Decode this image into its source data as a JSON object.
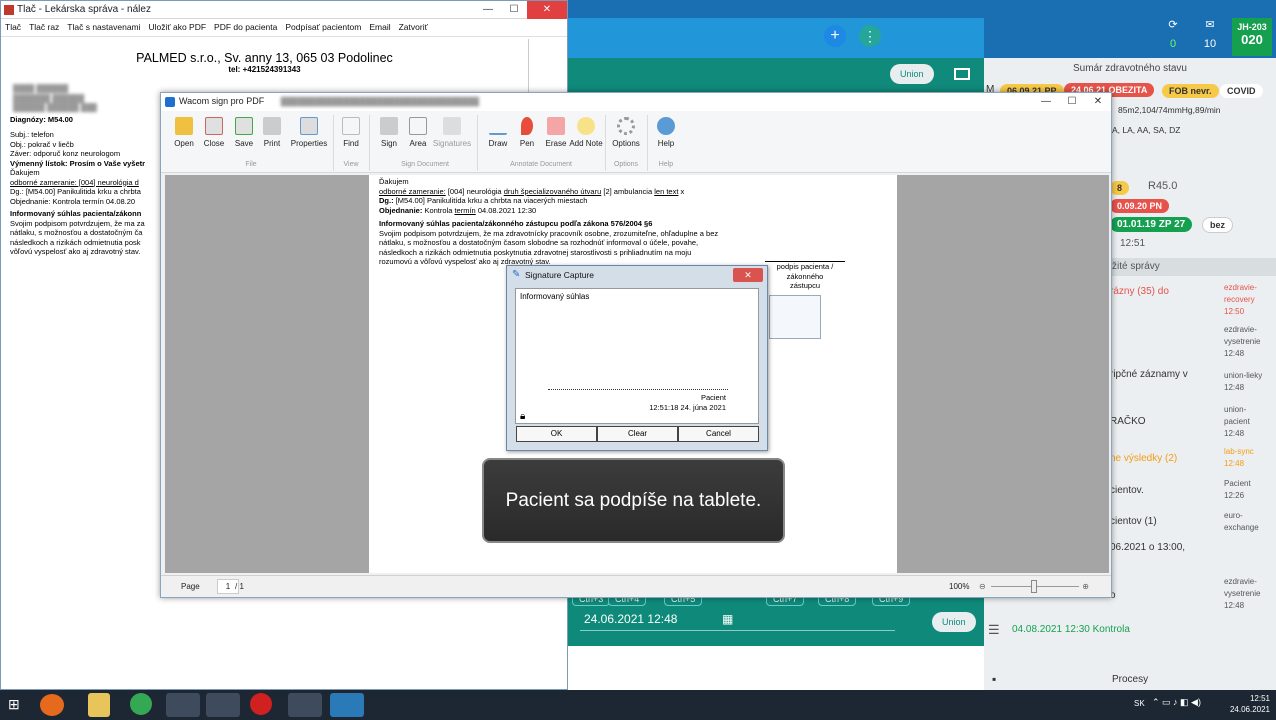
{
  "app": {
    "header_stats": {
      "sync_count": "0",
      "msg_count": "10",
      "user_code": "JH-203",
      "user_num": "020"
    },
    "union_label": "Union",
    "summary_title": "Sumár zdravotného stavu",
    "tags": {
      "m": "M",
      "pp": "06.09.21 PP",
      "obezita": "24.06.21 OBEZITA",
      "fob": "FOB nevr.",
      "covid": "COVID",
      "vitals": "85m2,104/74mmHg,89/min",
      "dx_list": "A, LA, AA, SA, DZ",
      "r45": "R45.0",
      "pn": "0.09.20 PN",
      "zp": "01.01.19 ZP 27",
      "bez": "bez",
      "time": "12:51",
      "small": "8"
    },
    "right_section_title": "žité správy",
    "right_items": [
      {
        "label": "rázny (35) do",
        "status": "ezdravie-\nrecovery\n12:50"
      },
      {
        "label": "",
        "status": "ezdravie-\nvysetrenie\n12:48"
      },
      {
        "label": "ripčné záznamy v\n",
        "status": "union-lieky\n12:48"
      },
      {
        "label": "RAČKO",
        "status": "union-\npacient\n12:48"
      },
      {
        "label": "ne výsledky (2)",
        "status": "lab-sync\n12:48"
      },
      {
        "label": "cientov.",
        "status": "Pacient\n12:26"
      },
      {
        "label": "cientov (1)",
        "status": "euro-\nexchange"
      },
      {
        "label": "06.2021 o 13:00,",
        "status": ""
      },
      {
        "label": "o",
        "status": "ezdravie-\nvysetrenie\n12:48"
      }
    ],
    "kontrola": "04.08.2021 12:30 Kontrola",
    "procesy": "Procesy",
    "date_field": "24.06.2021 12:48",
    "ctrl_tabs": [
      "Ctrl+3",
      "Ctrl+4",
      "Ctrl+5",
      "Ctrl+7",
      "Ctrl+8",
      "Ctrl+9"
    ]
  },
  "print_window": {
    "title": "Tlač - Lekárska správa - nález",
    "menu": [
      "Tlač",
      "Tlač raz",
      "Tlač s nastavenami",
      "Uložiť ako PDF",
      "PDF do pacienta",
      "Podpísať pacientom",
      "Email",
      "Zatvoriť"
    ],
    "org": "PALMED s.r.o., Sv. anny 13, 065 03 Podolinec",
    "tel": "tel: +421524391343",
    "lines": [
      "Diagnózy: M54.00",
      "Subj.: telefon",
      "Obj.: pokrač v liečb",
      "Záver: odporuč konz neurologom",
      "Výmenný lístok: Prosím o Vaše vyšetr",
      "Ďakujem",
      "odborné zameranie: [004] neurológia d",
      "Dg.: [M54.00] Panikulitida krku a chrbta",
      "Objednanie: Kontrola termín 04.08.20",
      "Informovaný súhlas pacienta/zákonn",
      "Svojim podpisom potvrdzujem, že ma za",
      "nátlaku, s možnosťou a dostatočným ča",
      "následkoch a rizikách odmietnutia posk",
      "vôľovú vyspelosť ako aj zdravotný stav."
    ]
  },
  "wacom": {
    "title": "Wacom sign pro PDF",
    "ribbon": [
      {
        "label": "Open",
        "icon": "folder-open-icon"
      },
      {
        "label": "Close",
        "icon": "close-doc-icon"
      },
      {
        "label": "Save",
        "icon": "save-icon"
      },
      {
        "label": "Print",
        "icon": "print-icon"
      },
      {
        "label": "Properties",
        "icon": "properties-icon"
      },
      {
        "label": "Find",
        "icon": "find-icon"
      },
      {
        "label": "Sign",
        "icon": "sign-icon"
      },
      {
        "label": "Area",
        "icon": "area-icon"
      },
      {
        "label": "Signatures",
        "icon": "signatures-icon"
      },
      {
        "label": "Draw",
        "icon": "draw-icon"
      },
      {
        "label": "Pen",
        "icon": "pen-icon"
      },
      {
        "label": "Erase",
        "icon": "erase-icon"
      },
      {
        "label": "Add Note",
        "icon": "note-icon"
      },
      {
        "label": "Options",
        "icon": "options-gear-icon"
      },
      {
        "label": "Help",
        "icon": "help-icon"
      }
    ],
    "groups": [
      "File",
      "View",
      "Sign Document",
      "Annotate Document",
      "Options",
      "Help"
    ],
    "doc_lines": {
      "l1": "Ďakujem",
      "l2a": "odborné zameranie:",
      "l2b": "[004] neurológia",
      "l2c": "druh špecializovaného útvaru",
      "l2d": "[2] ambulancia",
      "l2e": "len text",
      "l2f": "x",
      "l3a": "Dg.:",
      "l3b": "[M54.00] Panikulitída krku a chrbta na viacerých miestach",
      "l4a": "Objednanie:",
      "l4b": "Kontrola",
      "l4c": "termín",
      "l4d": "04.08.2021 12:30",
      "heading": "Informovaný súhlas pacienta/zákonného zástupcu podľa zákona 576/2004 §6",
      "p1": "Svojim podpisom potvrdzujem, že ma zdravotnícky pracovník osobne, zrozumiteľne, ohľaduplne a bez",
      "p2": "nátlaku, s možnosťou a dostatočným časom slobodne sa rozhodnúť informoval o účele, povahe,",
      "p3": "následkoch a rizikách odmietnutia poskytnutia zdravotnej starostlivosti s prihliadnutím na moju",
      "p4": "rozumovú a vôľovú vyspelosť ako aj zdravotný stav.",
      "sig_label": "podpis pacienta /\nzákonného\nzástupcu"
    },
    "status": {
      "page_label": "Page",
      "page": "1",
      "of": "/ 1",
      "zoom": "100%"
    }
  },
  "signature": {
    "title": "Signature Capture",
    "close": "✕",
    "caption": "Informovaný súhlas",
    "signer": "Pacient",
    "timestamp": "12:51:18 24. júna 2021",
    "ok": "OK",
    "clear": "Clear",
    "cancel": "Cancel"
  },
  "caption": "Pacient sa podpíše na tablete.",
  "taskbar": {
    "lang": "SK",
    "time": "12:51",
    "date": "24.06.2021"
  }
}
